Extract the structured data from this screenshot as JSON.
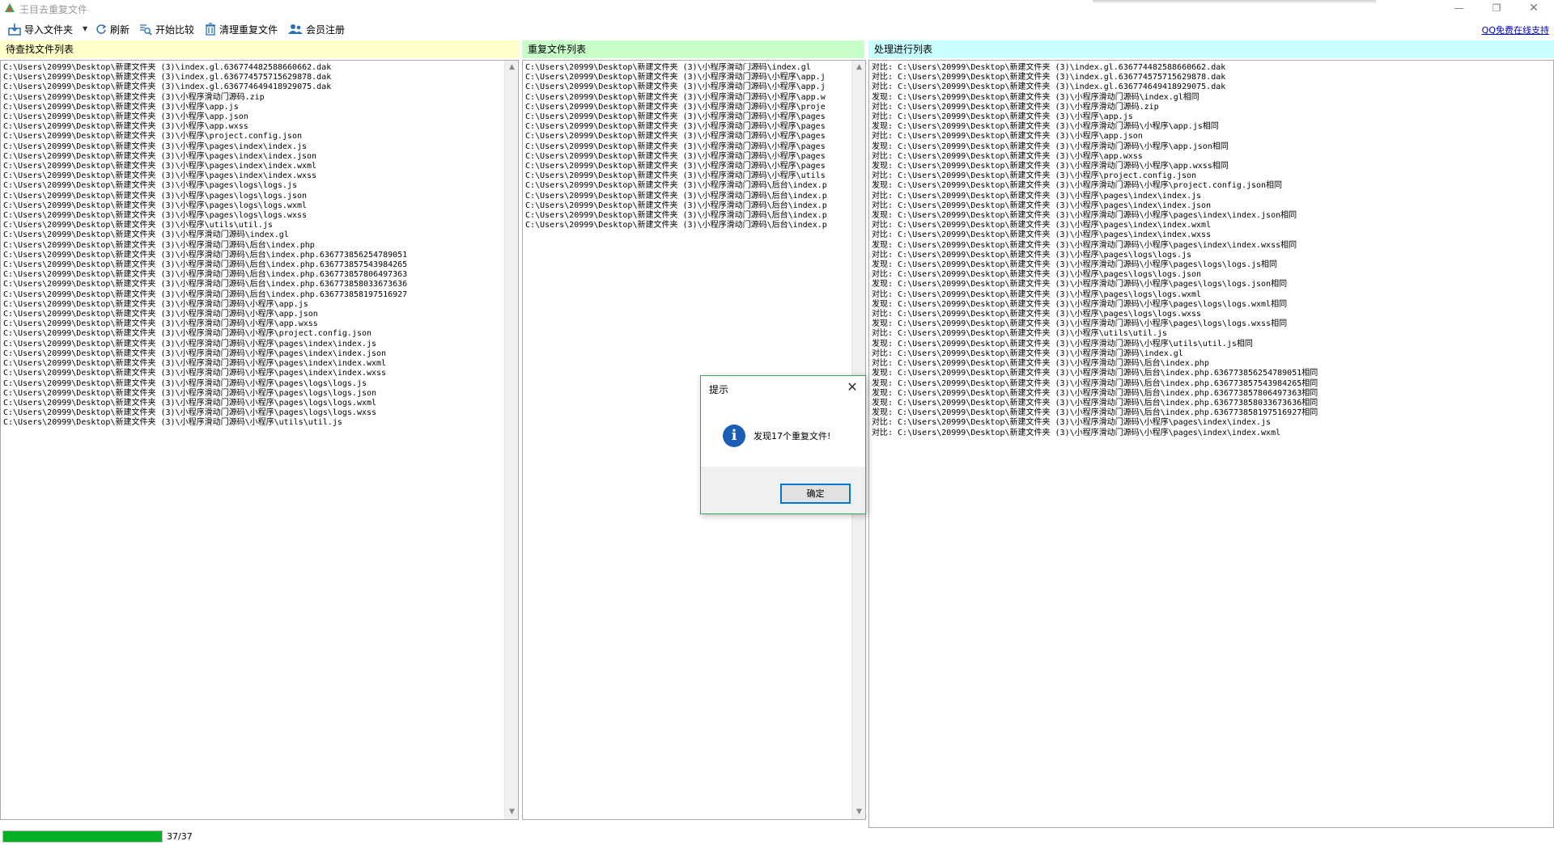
{
  "window": {
    "title": "王目去重复文件",
    "minimize_glyph": "—",
    "maximize_glyph": "❐",
    "close_glyph": "✕"
  },
  "toolbar": {
    "import_label": "导入文件夹",
    "dropdown_glyph": "▼",
    "refresh_label": "刷新",
    "compare_label": "开始比较",
    "clean_label": "清理重复文件",
    "register_label": "会员注册",
    "qq_link": "QQ免费在线支持"
  },
  "panels": {
    "pending": {
      "title": "待查找文件列表",
      "text": "C:\\Users\\20999\\Desktop\\新建文件夹 (3)\\index.gl.636774482588660662.dak\nC:\\Users\\20999\\Desktop\\新建文件夹 (3)\\index.gl.636774575715629878.dak\nC:\\Users\\20999\\Desktop\\新建文件夹 (3)\\index.gl.636774649418929075.dak\nC:\\Users\\20999\\Desktop\\新建文件夹 (3)\\小程序滑动门源码.zip\nC:\\Users\\20999\\Desktop\\新建文件夹 (3)\\小程序\\app.js\nC:\\Users\\20999\\Desktop\\新建文件夹 (3)\\小程序\\app.json\nC:\\Users\\20999\\Desktop\\新建文件夹 (3)\\小程序\\app.wxss\nC:\\Users\\20999\\Desktop\\新建文件夹 (3)\\小程序\\project.config.json\nC:\\Users\\20999\\Desktop\\新建文件夹 (3)\\小程序\\pages\\index\\index.js\nC:\\Users\\20999\\Desktop\\新建文件夹 (3)\\小程序\\pages\\index\\index.json\nC:\\Users\\20999\\Desktop\\新建文件夹 (3)\\小程序\\pages\\index\\index.wxml\nC:\\Users\\20999\\Desktop\\新建文件夹 (3)\\小程序\\pages\\index\\index.wxss\nC:\\Users\\20999\\Desktop\\新建文件夹 (3)\\小程序\\pages\\logs\\logs.js\nC:\\Users\\20999\\Desktop\\新建文件夹 (3)\\小程序\\pages\\logs\\logs.json\nC:\\Users\\20999\\Desktop\\新建文件夹 (3)\\小程序\\pages\\logs\\logs.wxml\nC:\\Users\\20999\\Desktop\\新建文件夹 (3)\\小程序\\pages\\logs\\logs.wxss\nC:\\Users\\20999\\Desktop\\新建文件夹 (3)\\小程序\\utils\\util.js\nC:\\Users\\20999\\Desktop\\新建文件夹 (3)\\小程序滑动门源码\\index.gl\nC:\\Users\\20999\\Desktop\\新建文件夹 (3)\\小程序滑动门源码\\后台\\index.php\nC:\\Users\\20999\\Desktop\\新建文件夹 (3)\\小程序滑动门源码\\后台\\index.php.636773856254789051\nC:\\Users\\20999\\Desktop\\新建文件夹 (3)\\小程序滑动门源码\\后台\\index.php.636773857543984265\nC:\\Users\\20999\\Desktop\\新建文件夹 (3)\\小程序滑动门源码\\后台\\index.php.636773857806497363\nC:\\Users\\20999\\Desktop\\新建文件夹 (3)\\小程序滑动门源码\\后台\\index.php.636773858033673636\nC:\\Users\\20999\\Desktop\\新建文件夹 (3)\\小程序滑动门源码\\后台\\index.php.636773858197516927\nC:\\Users\\20999\\Desktop\\新建文件夹 (3)\\小程序滑动门源码\\小程序\\app.js\nC:\\Users\\20999\\Desktop\\新建文件夹 (3)\\小程序滑动门源码\\小程序\\app.json\nC:\\Users\\20999\\Desktop\\新建文件夹 (3)\\小程序滑动门源码\\小程序\\app.wxss\nC:\\Users\\20999\\Desktop\\新建文件夹 (3)\\小程序滑动门源码\\小程序\\project.config.json\nC:\\Users\\20999\\Desktop\\新建文件夹 (3)\\小程序滑动门源码\\小程序\\pages\\index\\index.js\nC:\\Users\\20999\\Desktop\\新建文件夹 (3)\\小程序滑动门源码\\小程序\\pages\\index\\index.json\nC:\\Users\\20999\\Desktop\\新建文件夹 (3)\\小程序滑动门源码\\小程序\\pages\\index\\index.wxml\nC:\\Users\\20999\\Desktop\\新建文件夹 (3)\\小程序滑动门源码\\小程序\\pages\\index\\index.wxss\nC:\\Users\\20999\\Desktop\\新建文件夹 (3)\\小程序滑动门源码\\小程序\\pages\\logs\\logs.js\nC:\\Users\\20999\\Desktop\\新建文件夹 (3)\\小程序滑动门源码\\小程序\\pages\\logs\\logs.json\nC:\\Users\\20999\\Desktop\\新建文件夹 (3)\\小程序滑动门源码\\小程序\\pages\\logs\\logs.wxml\nC:\\Users\\20999\\Desktop\\新建文件夹 (3)\\小程序滑动门源码\\小程序\\pages\\logs\\logs.wxss\nC:\\Users\\20999\\Desktop\\新建文件夹 (3)\\小程序滑动门源码\\小程序\\utils\\util.js"
    },
    "duplicates": {
      "title": "重复文件列表",
      "text": "C:\\Users\\20999\\Desktop\\新建文件夹 (3)\\小程序滑动门源码\\index.gl\nC:\\Users\\20999\\Desktop\\新建文件夹 (3)\\小程序滑动门源码\\小程序\\app.j\nC:\\Users\\20999\\Desktop\\新建文件夹 (3)\\小程序滑动门源码\\小程序\\app.j\nC:\\Users\\20999\\Desktop\\新建文件夹 (3)\\小程序滑动门源码\\小程序\\app.w\nC:\\Users\\20999\\Desktop\\新建文件夹 (3)\\小程序滑动门源码\\小程序\\proje\nC:\\Users\\20999\\Desktop\\新建文件夹 (3)\\小程序滑动门源码\\小程序\\pages\nC:\\Users\\20999\\Desktop\\新建文件夹 (3)\\小程序滑动门源码\\小程序\\pages\nC:\\Users\\20999\\Desktop\\新建文件夹 (3)\\小程序滑动门源码\\小程序\\pages\nC:\\Users\\20999\\Desktop\\新建文件夹 (3)\\小程序滑动门源码\\小程序\\pages\nC:\\Users\\20999\\Desktop\\新建文件夹 (3)\\小程序滑动门源码\\小程序\\pages\nC:\\Users\\20999\\Desktop\\新建文件夹 (3)\\小程序滑动门源码\\小程序\\pages\nC:\\Users\\20999\\Desktop\\新建文件夹 (3)\\小程序滑动门源码\\小程序\\utils\nC:\\Users\\20999\\Desktop\\新建文件夹 (3)\\小程序滑动门源码\\后台\\index.p\nC:\\Users\\20999\\Desktop\\新建文件夹 (3)\\小程序滑动门源码\\后台\\index.p\nC:\\Users\\20999\\Desktop\\新建文件夹 (3)\\小程序滑动门源码\\后台\\index.p\nC:\\Users\\20999\\Desktop\\新建文件夹 (3)\\小程序滑动门源码\\后台\\index.p\nC:\\Users\\20999\\Desktop\\新建文件夹 (3)\\小程序滑动门源码\\后台\\index.p"
    },
    "processing": {
      "title": "处理进行列表",
      "text": "对比: C:\\Users\\20999\\Desktop\\新建文件夹 (3)\\index.gl.636774482588660662.dak\n对比: C:\\Users\\20999\\Desktop\\新建文件夹 (3)\\index.gl.636774575715629878.dak\n对比: C:\\Users\\20999\\Desktop\\新建文件夹 (3)\\index.gl.636774649418929075.dak\n发现: C:\\Users\\20999\\Desktop\\新建文件夹 (3)\\小程序滑动门源码\\index.gl相同\n对比: C:\\Users\\20999\\Desktop\\新建文件夹 (3)\\小程序滑动门源码.zip\n对比: C:\\Users\\20999\\Desktop\\新建文件夹 (3)\\小程序\\app.js\n发现: C:\\Users\\20999\\Desktop\\新建文件夹 (3)\\小程序滑动门源码\\小程序\\app.js相同\n对比: C:\\Users\\20999\\Desktop\\新建文件夹 (3)\\小程序\\app.json\n发现: C:\\Users\\20999\\Desktop\\新建文件夹 (3)\\小程序滑动门源码\\小程序\\app.json相同\n对比: C:\\Users\\20999\\Desktop\\新建文件夹 (3)\\小程序\\app.wxss\n发现: C:\\Users\\20999\\Desktop\\新建文件夹 (3)\\小程序滑动门源码\\小程序\\app.wxss相同\n对比: C:\\Users\\20999\\Desktop\\新建文件夹 (3)\\小程序\\project.config.json\n发现: C:\\Users\\20999\\Desktop\\新建文件夹 (3)\\小程序滑动门源码\\小程序\\project.config.json相同\n对比: C:\\Users\\20999\\Desktop\\新建文件夹 (3)\\小程序\\pages\\index\\index.js\n对比: C:\\Users\\20999\\Desktop\\新建文件夹 (3)\\小程序\\pages\\index\\index.json\n发现: C:\\Users\\20999\\Desktop\\新建文件夹 (3)\\小程序滑动门源码\\小程序\\pages\\index\\index.json相同\n对比: C:\\Users\\20999\\Desktop\\新建文件夹 (3)\\小程序\\pages\\index\\index.wxml\n对比: C:\\Users\\20999\\Desktop\\新建文件夹 (3)\\小程序\\pages\\index\\index.wxss\n发现: C:\\Users\\20999\\Desktop\\新建文件夹 (3)\\小程序滑动门源码\\小程序\\pages\\index\\index.wxss相同\n对比: C:\\Users\\20999\\Desktop\\新建文件夹 (3)\\小程序\\pages\\logs\\logs.js\n发现: C:\\Users\\20999\\Desktop\\新建文件夹 (3)\\小程序滑动门源码\\小程序\\pages\\logs\\logs.js相同\n对比: C:\\Users\\20999\\Desktop\\新建文件夹 (3)\\小程序\\pages\\logs\\logs.json\n发现: C:\\Users\\20999\\Desktop\\新建文件夹 (3)\\小程序滑动门源码\\小程序\\pages\\logs\\logs.json相同\n对比: C:\\Users\\20999\\Desktop\\新建文件夹 (3)\\小程序\\pages\\logs\\logs.wxml\n发现: C:\\Users\\20999\\Desktop\\新建文件夹 (3)\\小程序滑动门源码\\小程序\\pages\\logs\\logs.wxml相同\n对比: C:\\Users\\20999\\Desktop\\新建文件夹 (3)\\小程序\\pages\\logs\\logs.wxss\n发现: C:\\Users\\20999\\Desktop\\新建文件夹 (3)\\小程序滑动门源码\\小程序\\pages\\logs\\logs.wxss相同\n对比: C:\\Users\\20999\\Desktop\\新建文件夹 (3)\\小程序\\utils\\util.js\n发现: C:\\Users\\20999\\Desktop\\新建文件夹 (3)\\小程序滑动门源码\\小程序\\utils\\util.js相同\n对比: C:\\Users\\20999\\Desktop\\新建文件夹 (3)\\小程序滑动门源码\\index.gl\n对比: C:\\Users\\20999\\Desktop\\新建文件夹 (3)\\小程序滑动门源码\\后台\\index.php\n发现: C:\\Users\\20999\\Desktop\\新建文件夹 (3)\\小程序滑动门源码\\后台\\index.php.636773856254789051相同\n发现: C:\\Users\\20999\\Desktop\\新建文件夹 (3)\\小程序滑动门源码\\后台\\index.php.636773857543984265相同\n发现: C:\\Users\\20999\\Desktop\\新建文件夹 (3)\\小程序滑动门源码\\后台\\index.php.636773857806497363相同\n发现: C:\\Users\\20999\\Desktop\\新建文件夹 (3)\\小程序滑动门源码\\后台\\index.php.636773858033673636相同\n发现: C:\\Users\\20999\\Desktop\\新建文件夹 (3)\\小程序滑动门源码\\后台\\index.php.636773858197516927相同\n对比: C:\\Users\\20999\\Desktop\\新建文件夹 (3)\\小程序滑动门源码\\小程序\\pages\\index\\index.js\n对比: C:\\Users\\20999\\Desktop\\新建文件夹 (3)\\小程序滑动门源码\\小程序\\pages\\index\\index.wxml"
    }
  },
  "scrollbar": {
    "up_glyph": "▲",
    "down_glyph": "▼"
  },
  "status": {
    "progress_value": 37,
    "progress_max": 37,
    "progress_text": "37/37",
    "progress_color": "#06b025"
  },
  "dialog": {
    "title": "提示",
    "close_glyph": "✕",
    "icon_glyph": "i",
    "message": "发现17个重复文件!",
    "ok_label": "确定"
  },
  "colors": {
    "pending_header": "#ffffc8",
    "duplicates_header": "#c8ffc8",
    "processing_header": "#c8ffff",
    "link": "#0000cc"
  }
}
